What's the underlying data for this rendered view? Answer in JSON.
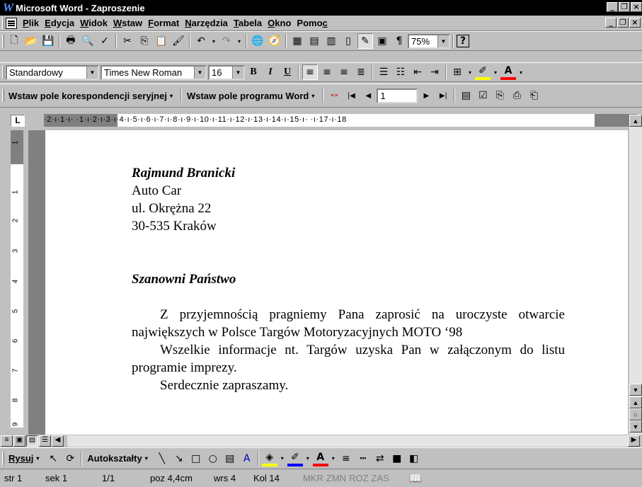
{
  "window": {
    "title": "Microsoft Word - Zaproszenie",
    "app_icon": "W"
  },
  "menu": {
    "items": [
      {
        "u": "P",
        "rest": "lik"
      },
      {
        "u": "E",
        "rest": "dycja"
      },
      {
        "u": "W",
        "rest": "idok"
      },
      {
        "u": "W",
        "rest": "s​taw"
      },
      {
        "u": "F",
        "rest": "ormat"
      },
      {
        "u": "N",
        "rest": "arzędzia"
      },
      {
        "u": "T",
        "rest": "abela"
      },
      {
        "u": "O",
        "rest": "kno"
      },
      {
        "u": "Pomo",
        "rest": "c"
      }
    ]
  },
  "standard_toolbar": {
    "zoom": "75%",
    "help": "?"
  },
  "formatting_toolbar": {
    "style": "Standardowy",
    "font": "Times New Roman",
    "size": "16",
    "bold": "B",
    "italic": "I",
    "underline": "U"
  },
  "mailmerge_toolbar": {
    "insert_merge_field": "Wstaw pole korespondencji seryjnej",
    "insert_word_field": "Wstaw pole programu Word",
    "record": "1"
  },
  "ruler": {
    "horizontal": "·2·ı·1·ı·   ·1·ı·2·ı·3·ı·4·ı·5·ı·6·ı·7·ı·8·ı·9·ı·10·ı·11·ı·12·ı·13·ı·14·ı·15·ı·  ·ı·17·ı·18",
    "vertical_marks": [
      "1",
      "1",
      "2",
      "3",
      "4",
      "5",
      "6",
      "7",
      "8",
      "9"
    ]
  },
  "document": {
    "name": "Rajmund Branicki",
    "company": "Auto Car",
    "street": "ul. Okrężna 22",
    "city": "30-535 Kraków",
    "salutation": "Szanowni Państwo",
    "para1": "Z przyjemnością pragniemy Pana zaprosić na uroczyste otwarcie największych w Polsce Targów Motoryzacyjnych MOTO ‘98",
    "para2": "Wszelkie informacje nt. Targów uzyska Pan w załączonym do listu programie imprezy.",
    "para3": "Serdecznie zapraszamy."
  },
  "drawing_toolbar": {
    "draw": "Rysuj",
    "autoshapes": "Autokształty"
  },
  "status": {
    "page": "str 1",
    "section": "sek 1",
    "pages": "1/1",
    "position": "poz 4,4cm",
    "line": "wrs 4",
    "column": "Kol 14",
    "mkr": "MKR",
    "zmn": "ZMN",
    "roz": "ROZ",
    "zas": "ZAS"
  }
}
